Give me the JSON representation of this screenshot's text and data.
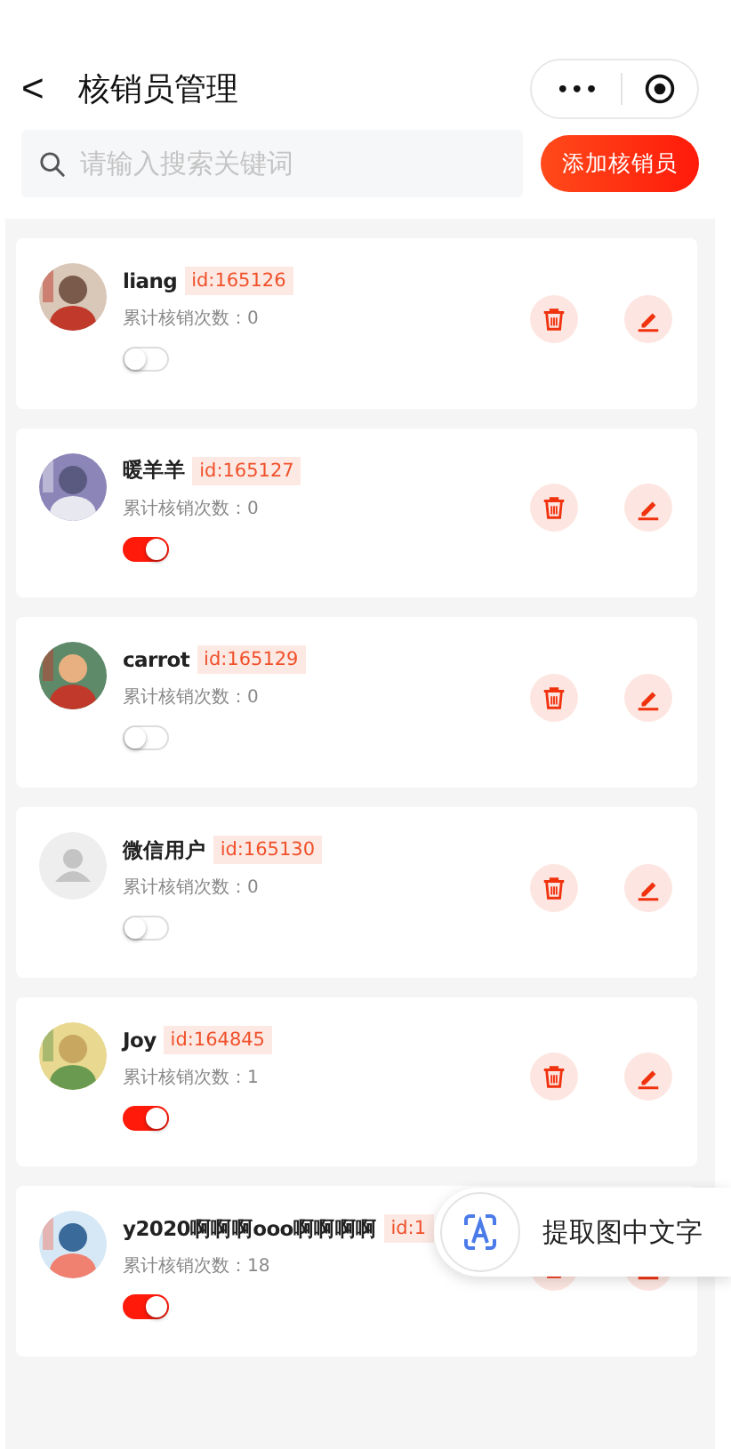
{
  "header": {
    "back": "<",
    "title": "核销员管理",
    "capsule_more": "•••"
  },
  "search": {
    "placeholder": "请输入搜索关键词"
  },
  "add_button": "添加核销员",
  "members": [
    {
      "name": "liang",
      "id": "id:165126",
      "count_label": "累计核销次数：0",
      "enabled": false
    },
    {
      "name": "暖羊羊",
      "id": "id:165127",
      "count_label": "累计核销次数：0",
      "enabled": true
    },
    {
      "name": "carrot",
      "id": "id:165129",
      "count_label": "累计核销次数：0",
      "enabled": false
    },
    {
      "avatar": {
        "kind": "default"
      },
      "name": "微信用户",
      "id": "id:165130",
      "count_label": "累计核销次数：0",
      "enabled": false
    },
    {
      "name": "Joy",
      "id": "id:164845",
      "count_label": "累计核销次数：1",
      "enabled": true
    },
    {
      "name": "y2020啊啊啊ooo啊啊啊啊",
      "id": "id:1",
      "count_label": "累计核销次数：18",
      "enabled": true
    }
  ],
  "ocr_popup": {
    "label": "提取图中文字"
  }
}
